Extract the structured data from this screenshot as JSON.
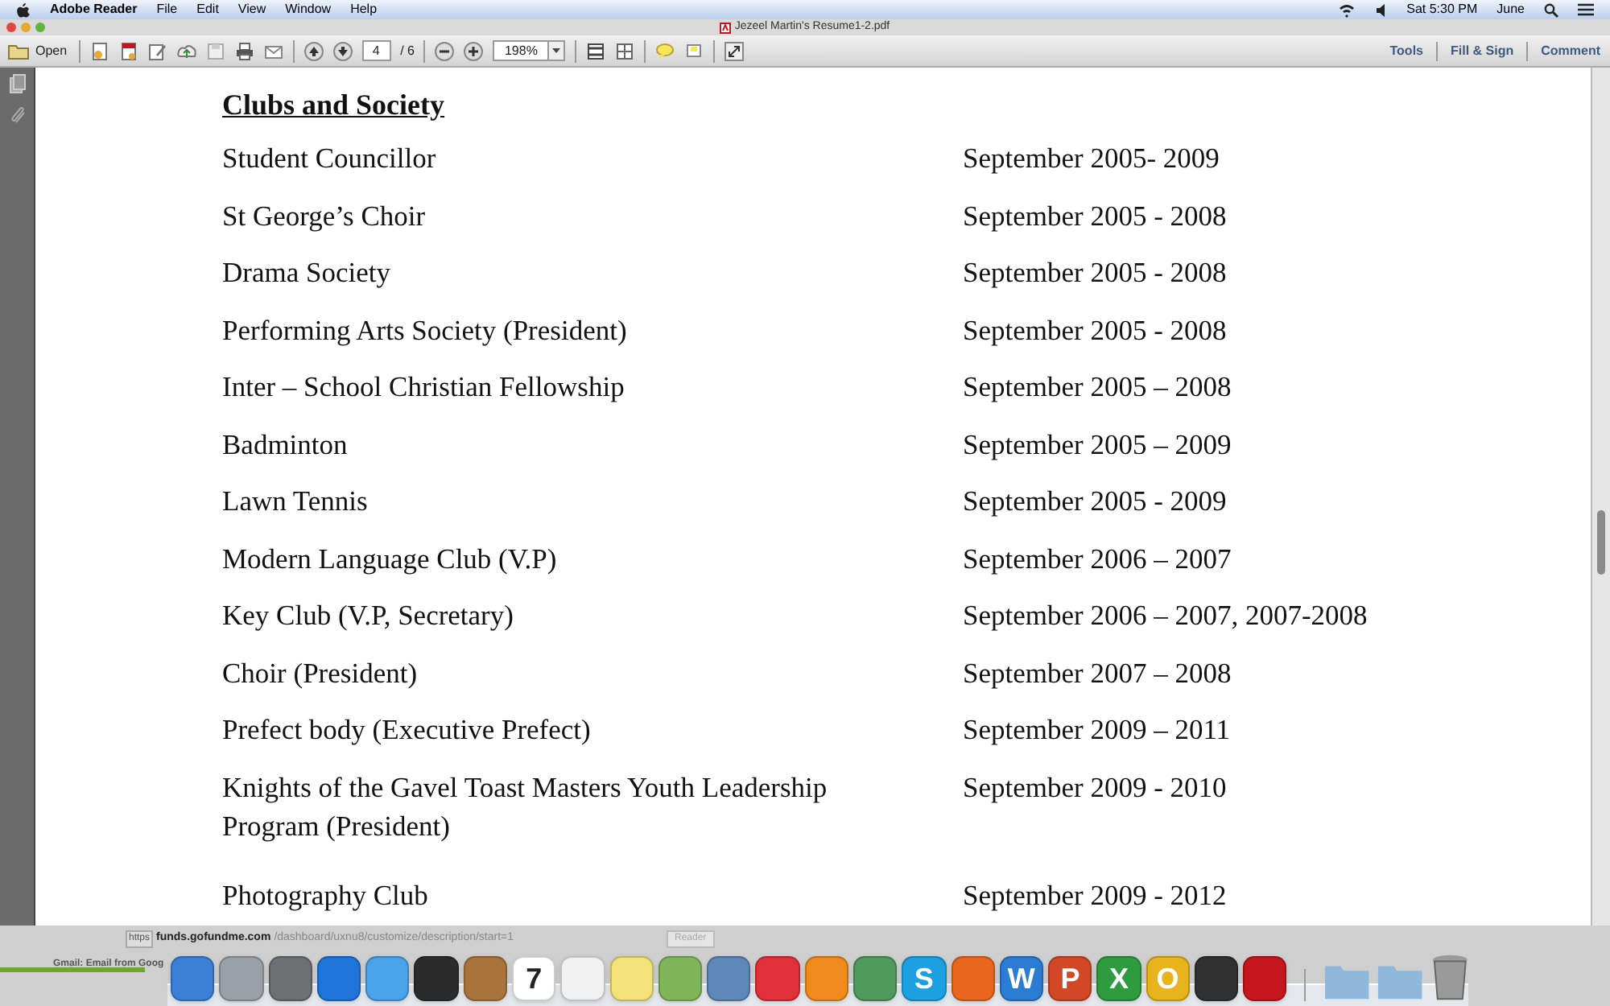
{
  "menu_bar": {
    "app": "Adobe Reader",
    "menus": [
      "File",
      "Edit",
      "View",
      "Window",
      "Help"
    ],
    "clock": "Sat 5:30 PM",
    "user": "June"
  },
  "window": {
    "title": "Jezeel Martin's Resume1-2.pdf"
  },
  "toolbar": {
    "open": "Open",
    "page": "4",
    "page_total": "/ 6",
    "zoom": "198%",
    "panels": [
      "Tools",
      "Fill & Sign",
      "Comment"
    ]
  },
  "document": {
    "heading": "Clubs and Society",
    "rows": [
      {
        "activity": "Student Councillor",
        "dates": "September 2005- 2009"
      },
      {
        "activity": "St George’s Choir",
        "dates": "September 2005 - 2008"
      },
      {
        "activity": "Drama Society",
        "dates": "September 2005 - 2008"
      },
      {
        "activity": "Performing Arts Society (President)",
        "dates": "September 2005 - 2008"
      },
      {
        "activity": "Inter – School Christian Fellowship",
        "dates": "September 2005 – 2008"
      },
      {
        "activity": "Badminton",
        "dates": "September 2005 – 2009"
      },
      {
        "activity": "Lawn Tennis",
        "dates": "September 2005 - 2009"
      },
      {
        "activity": "Modern Language Club (V.P)",
        "dates": "September 2006 – 2007"
      },
      {
        "activity": "Key Club (V.P, Secretary)",
        "dates": "September 2006 – 2007, 2007-2008"
      },
      {
        "activity": "Choir (President)",
        "dates": "September 2007 – 2008"
      },
      {
        "activity": "Prefect body (Executive Prefect)",
        "dates": "September 2009 – 2011"
      },
      {
        "activity": "Knights of the Gavel Toast Masters Youth Leadership Program (President)",
        "dates": "September 2009 - 2010"
      },
      {
        "activity": "Photography Club",
        "dates": "September 2009 - 2012"
      }
    ]
  },
  "background_browser": {
    "scheme": "https",
    "host": "funds.gofundme.com",
    "path": "/dashboard/uxnu8/customize/description/start=1",
    "bookmark": "Gmail: Email from Goog",
    "reader": "Reader"
  },
  "dock": [
    {
      "kind": "app",
      "color": "#3b7fd6"
    },
    {
      "kind": "app",
      "color": "#9aa0a8"
    },
    {
      "kind": "app",
      "color": "#6d6f73"
    },
    {
      "kind": "app",
      "color": "#1e74d8"
    },
    {
      "kind": "app",
      "color": "#4aa3e8"
    },
    {
      "kind": "app",
      "color": "#2b2b2b"
    },
    {
      "kind": "app",
      "color": "#a9743c"
    },
    {
      "kind": "app",
      "color": "#ffffff",
      "glyph": "7"
    },
    {
      "kind": "app",
      "color": "#f0f0f0"
    },
    {
      "kind": "app",
      "color": "#f3e27a"
    },
    {
      "kind": "app",
      "color": "#7fb65a"
    },
    {
      "kind": "app",
      "color": "#5d88b8"
    },
    {
      "kind": "app",
      "color": "#e2303a"
    },
    {
      "kind": "app",
      "color": "#f08a1c"
    },
    {
      "kind": "app",
      "color": "#4f9a5c"
    },
    {
      "kind": "app",
      "color": "#1ba1e2",
      "glyph": "S"
    },
    {
      "kind": "app",
      "color": "#e8661e"
    },
    {
      "kind": "app",
      "color": "#2b7cd3",
      "glyph": "W"
    },
    {
      "kind": "app",
      "color": "#d24726",
      "glyph": "P"
    },
    {
      "kind": "app",
      "color": "#2e9b3f",
      "glyph": "X"
    },
    {
      "kind": "app",
      "color": "#e8b41c",
      "glyph": "O"
    },
    {
      "kind": "app",
      "color": "#303030"
    },
    {
      "kind": "app",
      "color": "#c4161c"
    },
    {
      "kind": "folder",
      "color": "#8fb8dc"
    },
    {
      "kind": "folder",
      "color": "#8fb8dc"
    },
    {
      "kind": "trash",
      "color": "#9a9a9a"
    }
  ]
}
